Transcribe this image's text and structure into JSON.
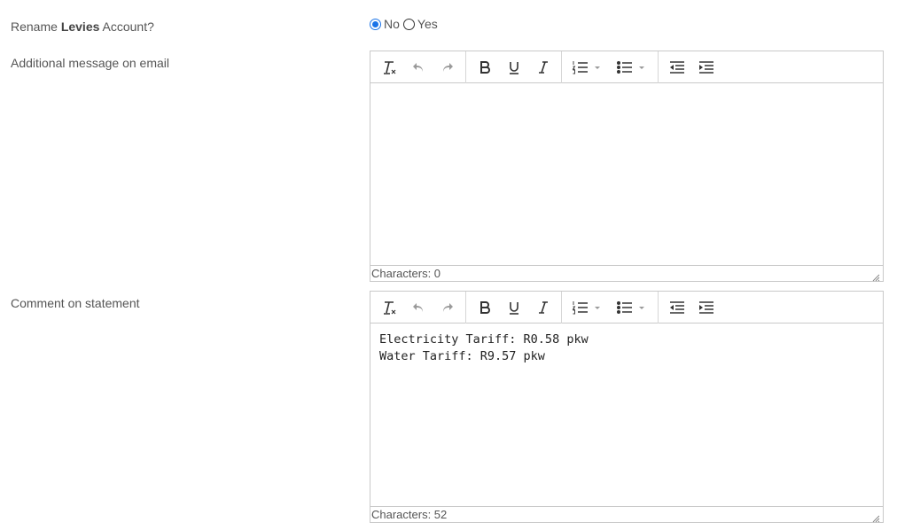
{
  "rename": {
    "label_prefix": "Rename ",
    "label_bold": "Levies",
    "label_suffix": " Account?",
    "options": [
      {
        "label": "No",
        "checked": true
      },
      {
        "label": "Yes",
        "checked": false
      }
    ]
  },
  "email_message": {
    "label": "Additional message on email",
    "content_lines": [],
    "status": "Characters: 0"
  },
  "statement_comment": {
    "label": "Comment on statement",
    "content_lines": [
      "Electricity Tariff: R0.58 pkw",
      "Water Tariff: R9.57 pkw"
    ],
    "status": "Characters: 52"
  },
  "toolbar_icons": [
    "clear-format-icon",
    "undo-icon",
    "redo-icon",
    "bold-icon",
    "underline-icon",
    "italic-icon",
    "numbered-list-icon",
    "bullet-list-icon",
    "outdent-icon",
    "indent-icon"
  ],
  "colors": {
    "accent": "#1a73e8",
    "border": "#c9c9c9",
    "text": "#555555"
  }
}
